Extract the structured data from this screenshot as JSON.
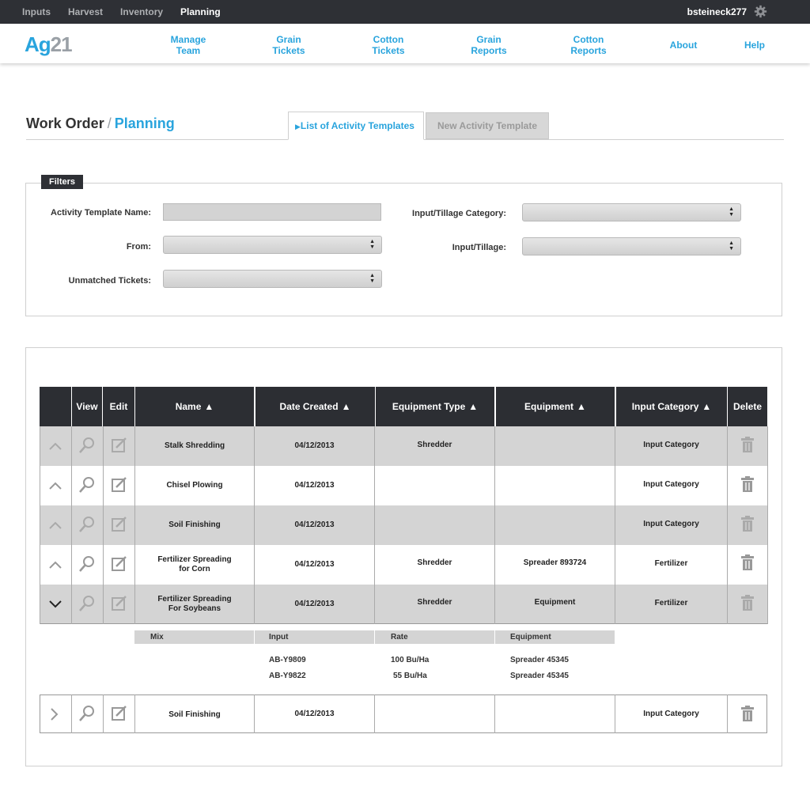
{
  "topbar": {
    "nav": [
      "Inputs",
      "Harvest",
      "Inventory",
      "Planning"
    ],
    "active": "Planning",
    "username": "bsteineck277"
  },
  "logo": {
    "part1": "Ag",
    "part2": "21"
  },
  "main_nav": [
    {
      "line1": "Manage",
      "line2": "Team"
    },
    {
      "line1": "Grain",
      "line2": "Tickets"
    },
    {
      "line1": "Cotton",
      "line2": "Tickets"
    },
    {
      "line1": "Grain",
      "line2": "Reports"
    },
    {
      "line1": "Cotton",
      "line2": "Reports"
    },
    {
      "line1": "About",
      "line2": ""
    },
    {
      "line1": "Help",
      "line2": ""
    }
  ],
  "page": {
    "title": "Work Order",
    "separator": "/",
    "subtitle": "Planning"
  },
  "tabs": {
    "list_templates": "List of Activity Templates",
    "new_template": "New Activity Template"
  },
  "filters": {
    "label": "Filters",
    "activity_template_name": {
      "label": "Activity Template Name:",
      "value": ""
    },
    "from": {
      "label": "From:",
      "value": ""
    },
    "unmatched_tickets": {
      "label": "Unmatched Tickets:",
      "value": ""
    },
    "input_tillage_category": {
      "label": "Input/Tillage Category:",
      "value": ""
    },
    "input_tillage": {
      "label": "Input/Tillage:",
      "value": ""
    }
  },
  "table": {
    "headers": [
      "",
      "View",
      "Edit",
      "Name",
      "Date Created",
      "Equipment Type",
      "Equipment",
      "Input Category",
      "Delete"
    ],
    "rows": [
      {
        "name": "Stalk Shredding",
        "name2": "",
        "date": "04/12/2013",
        "equipment_type": "Shredder",
        "equipment": "",
        "input_category": "Input Category"
      },
      {
        "name": "Chisel Plowing",
        "name2": "",
        "date": "04/12/2013",
        "equipment_type": "",
        "equipment": "",
        "input_category": "Input Category"
      },
      {
        "name": "Soil Finishing",
        "name2": "",
        "date": "04/12/2013",
        "equipment_type": "",
        "equipment": "",
        "input_category": "Input Category"
      },
      {
        "name": "Fertilizer Spreading",
        "name2": "for Corn",
        "date": "04/12/2013",
        "equipment_type": "Shredder",
        "equipment": "Spreader 893724",
        "input_category": "Fertilizer"
      },
      {
        "name": "Fertilizer Spreading",
        "name2": "For Soybeans",
        "date": "04/12/2013",
        "equipment_type": "Shredder",
        "equipment": "Equipment",
        "input_category": "Fertilizer"
      },
      {
        "name": "Soil Finishing",
        "name2": "",
        "date": "04/12/2013",
        "equipment_type": "",
        "equipment": "",
        "input_category": "Input Category"
      }
    ],
    "subtable": {
      "headers": [
        "Mix",
        "Input",
        "Rate",
        "Equipment"
      ],
      "rows": [
        {
          "input": "AB-Y9809",
          "rate": "100 Bu/Ha",
          "equipment": "Spreader 45345"
        },
        {
          "input": "AB-Y9822",
          "rate": "55 Bu/Ha",
          "equipment": "Spreader 45345"
        }
      ]
    }
  }
}
